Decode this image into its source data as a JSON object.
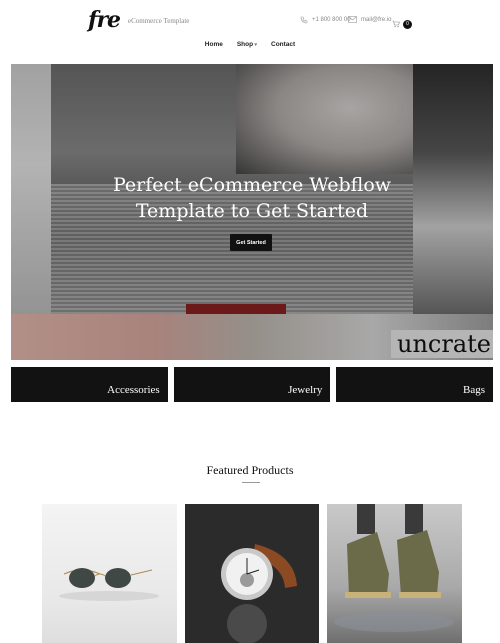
{
  "header": {
    "logo": "fre",
    "tagline": "eCommerce Template",
    "phone": "+1 800 800 00",
    "email": "mail@fre.io",
    "cart_count": "0"
  },
  "nav": {
    "items": [
      {
        "label": "Home"
      },
      {
        "label": "Shop"
      },
      {
        "label": "Contact"
      }
    ]
  },
  "hero": {
    "title_line1": "Perfect eCommerce Webflow",
    "title_line2": "Template to Get Started",
    "button_label": "Get Started",
    "magazine_text": "uncrate"
  },
  "categories": [
    {
      "label": "Accessories"
    },
    {
      "label": "Jewelry"
    },
    {
      "label": "Bags"
    }
  ],
  "featured": {
    "title": "Featured Products",
    "products": [
      {
        "image": "sunglasses"
      },
      {
        "image": "watch"
      },
      {
        "image": "sneakers"
      }
    ]
  },
  "icons": {
    "phone": "phone-icon",
    "mail": "mail-icon",
    "cart": "cart-icon"
  },
  "colors": {
    "accent": "#111111",
    "background": "#ffffff"
  }
}
